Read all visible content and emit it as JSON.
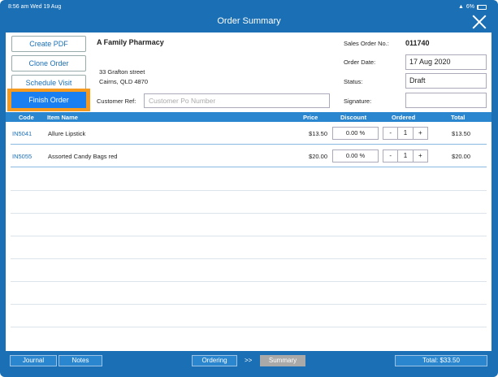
{
  "status_bar": {
    "time": "8:56 am  Wed 19 Aug",
    "wifi": "▲",
    "battery": "6%"
  },
  "header": {
    "title": "Order Summary"
  },
  "actions": {
    "create_pdf": "Create PDF",
    "clone_order": "Clone Order",
    "schedule_visit": "Schedule Visit",
    "finish_order": "Finish Order"
  },
  "customer": {
    "name": "A Family Pharmacy",
    "address_line1": "33 Grafton street",
    "address_line2": "Cairns, QLD 4870",
    "ref_label": "Customer Ref:",
    "ref_placeholder": "Customer Po Number"
  },
  "order": {
    "so_label": "Sales Order No.:",
    "so_value": "011740",
    "date_label": "Order Date:",
    "date_value": "17 Aug 2020",
    "status_label": "Status:",
    "status_value": "Draft",
    "signature_label": "Signature:"
  },
  "table": {
    "headers": {
      "code": "Code",
      "item_name": "Item Name",
      "price": "Price",
      "discount": "Discount",
      "ordered": "Ordered",
      "total": "Total"
    },
    "rows": [
      {
        "code": "IN5041",
        "name": "Allure Lipstick",
        "price": "$13.50",
        "discount": "0.00 %",
        "qty": "1",
        "total": "$13.50"
      },
      {
        "code": "IN5055",
        "name": "Assorted Candy Bags red",
        "price": "$20.00",
        "discount": "0.00 %",
        "qty": "1",
        "total": "$20.00"
      }
    ],
    "minus": "-",
    "plus": "+"
  },
  "footer": {
    "journal": "Journal",
    "notes": "Notes",
    "ordering": "Ordering",
    "arrows": ">>",
    "summary": "Summary",
    "total": "Total: $33.50"
  }
}
